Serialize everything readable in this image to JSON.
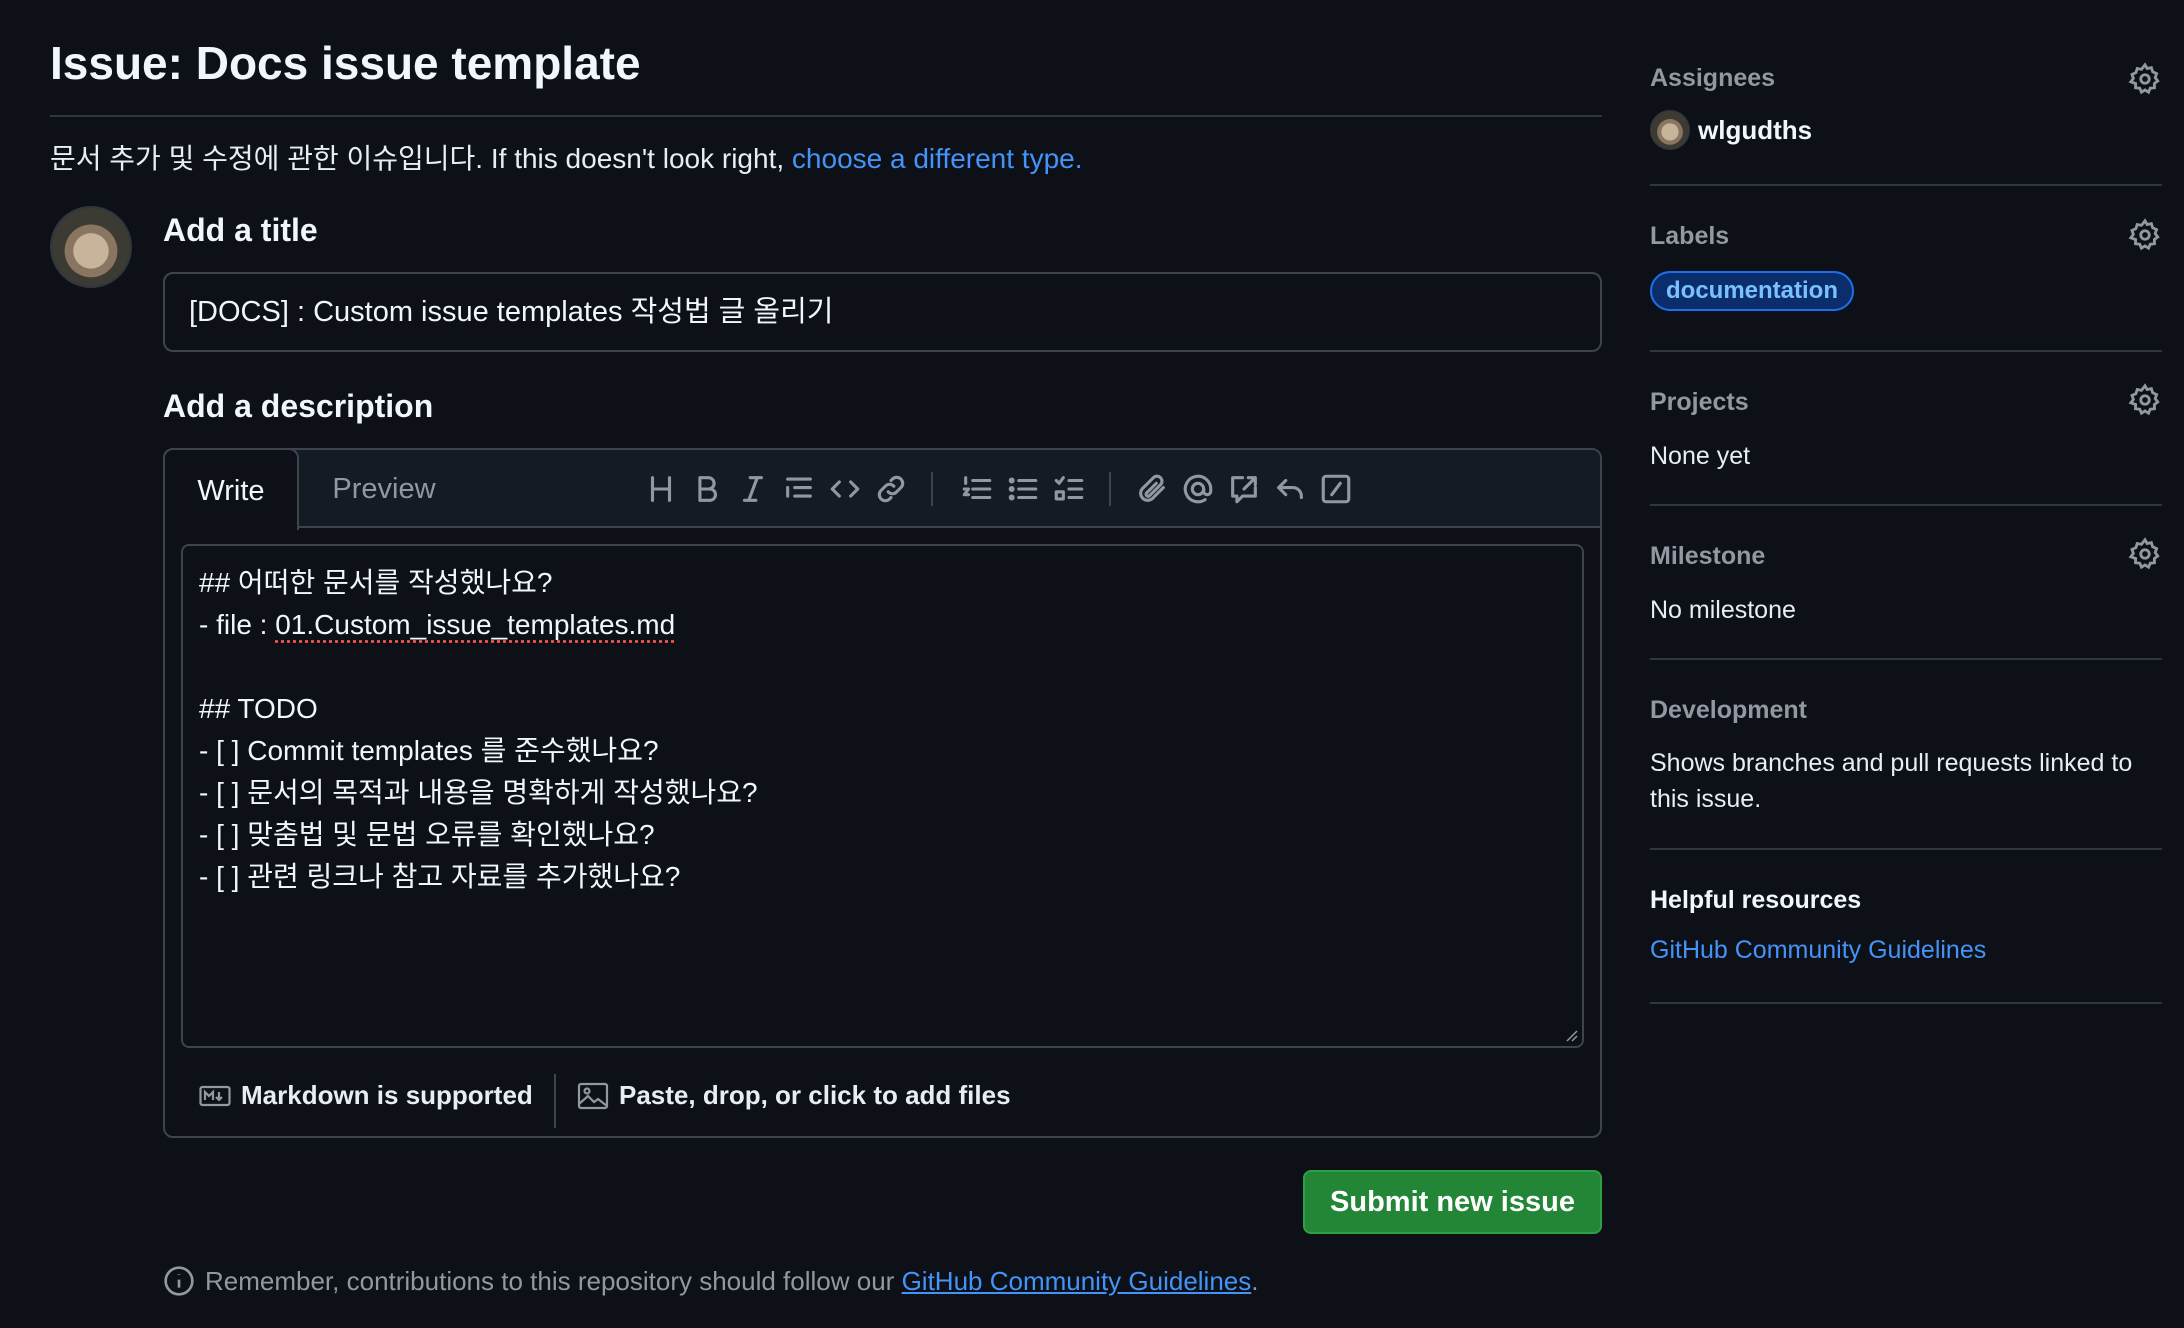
{
  "header": {
    "title": "Issue: Docs issue template",
    "intro_text": "문서 추가 및 수정에 관한 이슈입니다. If this doesn't look right, ",
    "intro_link": "choose a different type."
  },
  "form": {
    "title_label": "Add a title",
    "title_value": "[DOCS] : Custom issue templates 작성법 글 올리기",
    "description_label": "Add a description",
    "tabs": {
      "write": "Write",
      "preview": "Preview"
    },
    "toolbar_icons": [
      "heading-icon",
      "bold-icon",
      "italic-icon",
      "quote-icon",
      "code-icon",
      "link-icon",
      "ordered-list-icon",
      "unordered-list-icon",
      "task-list-icon",
      "attach-icon",
      "mention-icon",
      "reference-icon",
      "reply-icon",
      "slash-commands-icon"
    ],
    "body_lines": [
      "## 어떠한 문서를 작성했나요?",
      "- file : ",
      "01.Custom_issue_templates.md",
      "",
      "## TODO",
      "- [ ] Commit templates 를 준수했나요?",
      "- [ ] 문서의 목적과 내용을 명확하게 작성했나요?",
      "- [ ] 맞춤법 및 문법 오류를 확인했나요?",
      "- [ ] 관련 링크나 참고 자료를 추가했나요?"
    ],
    "markdown_note": "Markdown is supported",
    "attach_note": "Paste, drop, or click to add files",
    "submit_label": "Submit new issue",
    "footer_note": "Remember, contributions to this repository should follow our ",
    "footer_link": "GitHub Community Guidelines",
    "footer_end": "."
  },
  "sidebar": {
    "assignees": {
      "heading": "Assignees",
      "user": "wlgudths"
    },
    "labels": {
      "heading": "Labels",
      "label": "documentation"
    },
    "projects": {
      "heading": "Projects",
      "value": "None yet"
    },
    "milestone": {
      "heading": "Milestone",
      "value": "No milestone"
    },
    "development": {
      "heading": "Development",
      "value": "Shows branches and pull requests linked to this issue."
    },
    "helpful": {
      "heading": "Helpful resources",
      "link": "GitHub Community Guidelines"
    }
  },
  "colors": {
    "background": "#0d1117",
    "accent_link": "#4493f8",
    "submit_button": "#238636",
    "label_border": "#1f6feb"
  }
}
